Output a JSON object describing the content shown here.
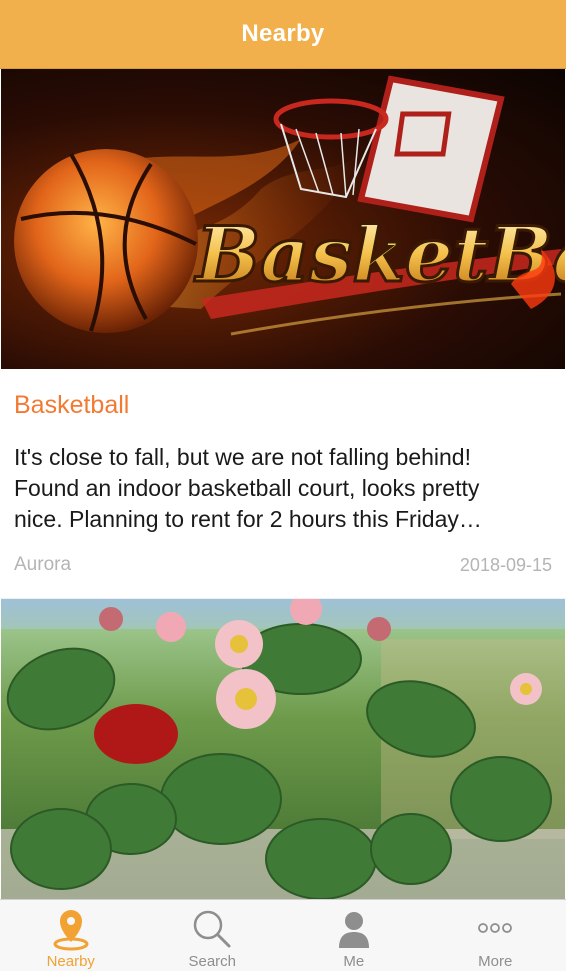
{
  "header": {
    "title": "Nearby"
  },
  "feed": {
    "posts": [
      {
        "image_alt": "Basketball",
        "image_text": "BasketBall",
        "title": "Basketball",
        "body_lines": [
          "It's close to fall, but we are not falling behind!",
          "Found an indoor basketball court, looks pretty",
          "nice. Planning to rent for 2 hours this Friday…"
        ],
        "author": "Aurora",
        "date": "2018-09-15"
      },
      {
        "image_alt": "Strawberry plant with flowers"
      }
    ]
  },
  "tabbar": {
    "tabs": [
      {
        "label": "Nearby",
        "icon": "location-pin-icon",
        "active": true
      },
      {
        "label": "Search",
        "icon": "search-icon",
        "active": false
      },
      {
        "label": "Me",
        "icon": "person-icon",
        "active": false
      },
      {
        "label": "More",
        "icon": "more-dots-icon",
        "active": false
      }
    ]
  },
  "colors": {
    "brand": "#f2b04c",
    "accent": "#f27a33",
    "tab_active": "#f2a233",
    "tab_inactive": "#8e8e8e"
  }
}
